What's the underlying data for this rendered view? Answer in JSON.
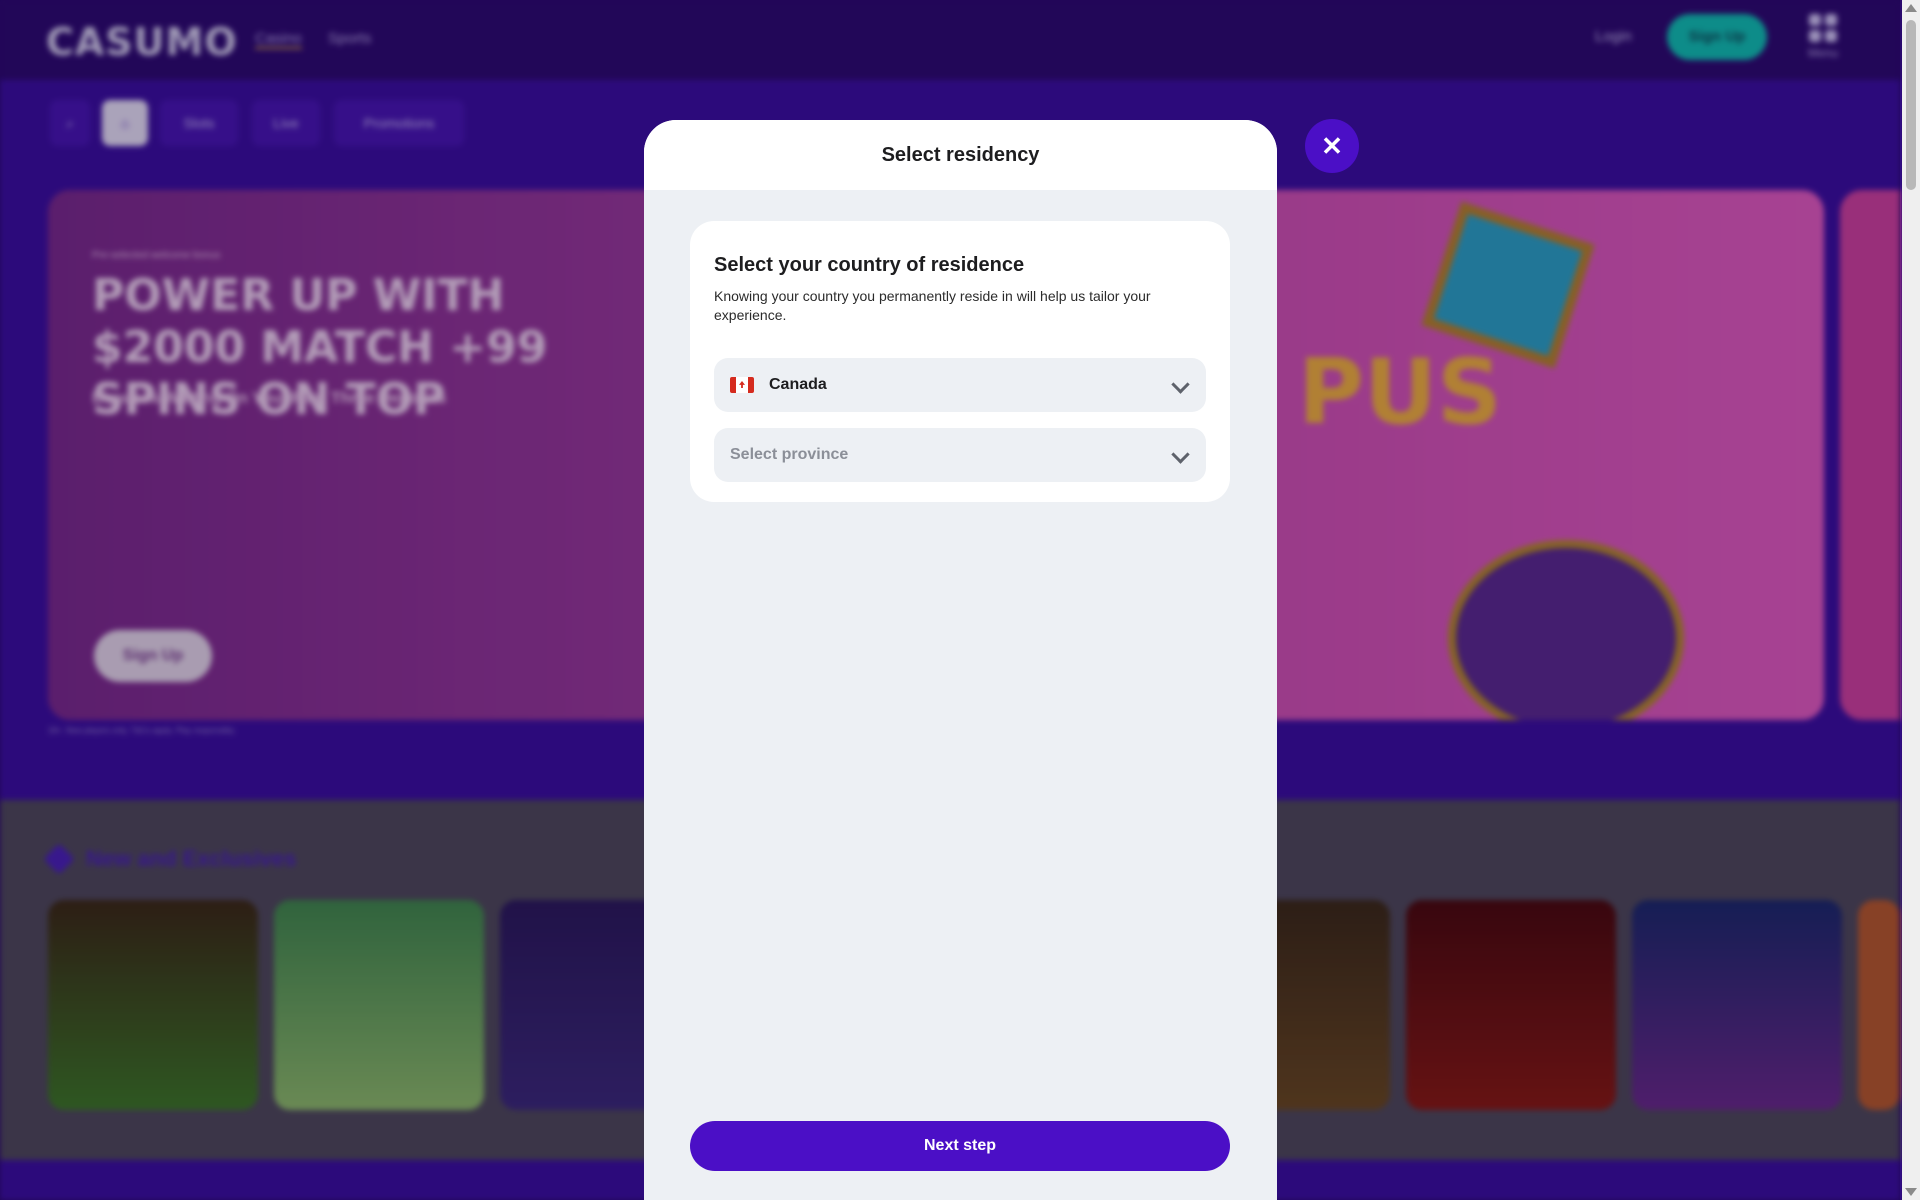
{
  "background_page": {
    "logo": "CASUMO",
    "nav": {
      "casino": "Casino",
      "sports": "Sports"
    },
    "login_label": "Login",
    "signup_label": "Sign Up",
    "menu_label": "Menu",
    "subnav": {
      "slots": "Slots",
      "live": "Live",
      "promotions": "Promotions"
    },
    "hero": {
      "small_text": "Pre-selected welcome bonus",
      "title": "POWER UP WITH $2000 MATCH +99 SPINS ON TOP",
      "subtitle": "Bonuses Waiting On Your First Three Deposits",
      "button_label": "Sign Up",
      "art_logo": "PUS"
    },
    "fine_print": "18+. New players only. T&Cs apply. Play responsibly.",
    "section_title": "New and Exclusives"
  },
  "modal": {
    "title": "Select residency",
    "close_glyph": "✕",
    "heading": "Select your country of residence",
    "description": "Knowing your country you permanently reside in will help us tailor your experience.",
    "country_value": "Canada",
    "province_placeholder": "Select province",
    "next_label": "Next step"
  },
  "colors": {
    "accent": "#4b0fc6",
    "page_bg": "#3a0fa0",
    "modal_bg": "#edf0f4",
    "teal": "#0fc2b3"
  },
  "icons": {
    "close": "close-icon",
    "chevron": "chevron-down-icon",
    "flag": "canada-flag-icon",
    "search": "search-icon",
    "home": "home-icon",
    "menu": "menu-grid-icon"
  }
}
